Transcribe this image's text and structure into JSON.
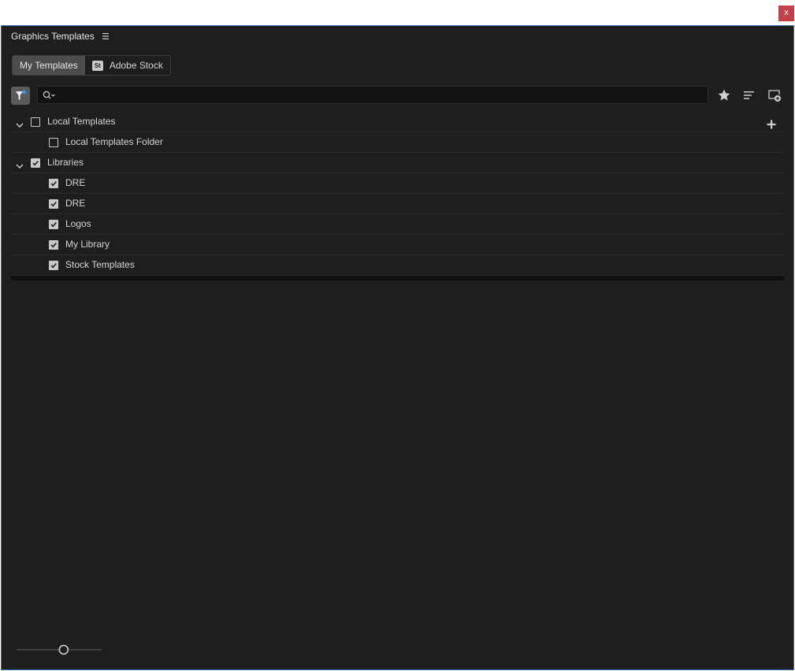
{
  "window": {
    "close_label": "x"
  },
  "panel": {
    "title": "Graphics Templates",
    "menu_icon": "hamburger-icon"
  },
  "tabs": [
    {
      "label": "My Templates",
      "active": true
    },
    {
      "label": "Adobe Stock",
      "badge": "St",
      "active": false
    }
  ],
  "toolbar": {
    "filter_icon": "filter-icon",
    "search_value": "",
    "search_icon": "search-icon",
    "favorite_icon": "star-icon",
    "sort_icon": "sort-icon",
    "new_item_icon": "new-item-icon"
  },
  "tree": {
    "groups": [
      {
        "label": "Local Templates",
        "checked": false,
        "expanded": true,
        "children": [
          {
            "label": "Local Templates Folder",
            "checked": false
          }
        ]
      },
      {
        "label": "Libraries",
        "checked": true,
        "expanded": true,
        "children": [
          {
            "label": "DRE",
            "checked": true
          },
          {
            "label": "DRE",
            "checked": true
          },
          {
            "label": "Logos",
            "checked": true
          },
          {
            "label": "My Library",
            "checked": true
          },
          {
            "label": "Stock Templates",
            "checked": true
          }
        ]
      }
    ]
  },
  "colors": {
    "panel_bg": "#1e1e1e",
    "panel_border": "#3a6fb8",
    "close_bg": "#c4414a",
    "filter_dot": "#2d9cff"
  },
  "zoom_slider": {
    "value": 0.56
  }
}
